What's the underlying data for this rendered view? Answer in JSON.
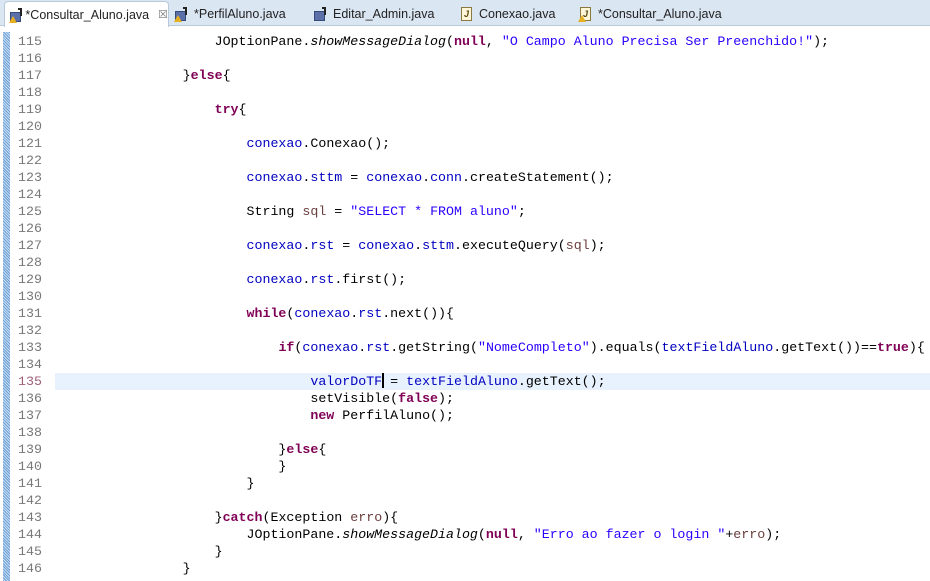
{
  "tabs": [
    {
      "label": "*Consultar_Aluno.java",
      "icon": "form-warning-icon",
      "active": true,
      "closable": true
    },
    {
      "label": "*PerfilAluno.java",
      "icon": "form-warning-icon",
      "active": false
    },
    {
      "label": "Editar_Admin.java",
      "icon": "form-icon",
      "active": false
    },
    {
      "label": "Conexao.java",
      "icon": "java-file-icon",
      "active": false
    },
    {
      "label": "*Consultar_Aluno.java",
      "icon": "java-file-warning-icon",
      "active": false
    }
  ],
  "close_glyph": "☒",
  "current_line": 135,
  "caret_after": "valorDoTF",
  "lines": [
    {
      "n": "115",
      "t": [
        [
          "p",
          "                    JOptionPane."
        ],
        [
          "it",
          "showMessageDialog"
        ],
        [
          "p",
          "("
        ],
        [
          "kw",
          "null"
        ],
        [
          "p",
          ", "
        ],
        [
          "str",
          "\"O Campo Aluno Precisa Ser Preenchido!\""
        ],
        [
          "p",
          ");"
        ]
      ]
    },
    {
      "n": "116",
      "t": []
    },
    {
      "n": "117",
      "t": [
        [
          "p",
          "                }"
        ],
        [
          "kw",
          "else"
        ],
        [
          "p",
          "{"
        ]
      ]
    },
    {
      "n": "118",
      "t": []
    },
    {
      "n": "119",
      "t": [
        [
          "p",
          "                    "
        ],
        [
          "kw",
          "try"
        ],
        [
          "p",
          "{"
        ]
      ]
    },
    {
      "n": "120",
      "t": []
    },
    {
      "n": "121",
      "t": [
        [
          "p",
          "                        "
        ],
        [
          "field",
          "conexao"
        ],
        [
          "p",
          ".Conexao();"
        ]
      ]
    },
    {
      "n": "122",
      "t": []
    },
    {
      "n": "123",
      "t": [
        [
          "p",
          "                        "
        ],
        [
          "field",
          "conexao"
        ],
        [
          "p",
          "."
        ],
        [
          "field",
          "sttm"
        ],
        [
          "p",
          " = "
        ],
        [
          "field",
          "conexao"
        ],
        [
          "p",
          "."
        ],
        [
          "field",
          "conn"
        ],
        [
          "p",
          ".createStatement();"
        ]
      ]
    },
    {
      "n": "124",
      "t": []
    },
    {
      "n": "125",
      "t": [
        [
          "p",
          "                        String "
        ],
        [
          "local",
          "sql"
        ],
        [
          "p",
          " = "
        ],
        [
          "str",
          "\"SELECT * FROM aluno\""
        ],
        [
          "p",
          ";"
        ]
      ]
    },
    {
      "n": "126",
      "t": []
    },
    {
      "n": "127",
      "t": [
        [
          "p",
          "                        "
        ],
        [
          "field",
          "conexao"
        ],
        [
          "p",
          "."
        ],
        [
          "field",
          "rst"
        ],
        [
          "p",
          " = "
        ],
        [
          "field",
          "conexao"
        ],
        [
          "p",
          "."
        ],
        [
          "field",
          "sttm"
        ],
        [
          "p",
          ".executeQuery("
        ],
        [
          "local",
          "sql"
        ],
        [
          "p",
          ");"
        ]
      ]
    },
    {
      "n": "128",
      "t": []
    },
    {
      "n": "129",
      "t": [
        [
          "p",
          "                        "
        ],
        [
          "field",
          "conexao"
        ],
        [
          "p",
          "."
        ],
        [
          "field",
          "rst"
        ],
        [
          "p",
          ".first();"
        ]
      ]
    },
    {
      "n": "130",
      "t": []
    },
    {
      "n": "131",
      "t": [
        [
          "p",
          "                        "
        ],
        [
          "kw",
          "while"
        ],
        [
          "p",
          "("
        ],
        [
          "field",
          "conexao"
        ],
        [
          "p",
          "."
        ],
        [
          "field",
          "rst"
        ],
        [
          "p",
          ".next()){"
        ]
      ]
    },
    {
      "n": "132",
      "t": []
    },
    {
      "n": "133",
      "t": [
        [
          "p",
          "                            "
        ],
        [
          "kw",
          "if"
        ],
        [
          "p",
          "("
        ],
        [
          "field",
          "conexao"
        ],
        [
          "p",
          "."
        ],
        [
          "field",
          "rst"
        ],
        [
          "p",
          ".getString("
        ],
        [
          "str",
          "\"NomeCompleto\""
        ],
        [
          "p",
          ").equals("
        ],
        [
          "field",
          "textFieldAluno"
        ],
        [
          "p",
          ".getText())=="
        ],
        [
          "kw",
          "true"
        ],
        [
          "p",
          "){"
        ]
      ]
    },
    {
      "n": "134",
      "t": []
    },
    {
      "n": "135",
      "t": [
        [
          "p",
          "                                "
        ],
        [
          "field",
          "valorDoTF"
        ],
        [
          "caret",
          ""
        ],
        [
          "p",
          " = "
        ],
        [
          "field",
          "textFieldAluno"
        ],
        [
          "p",
          ".getText();"
        ]
      ]
    },
    {
      "n": "136",
      "t": [
        [
          "p",
          "                                setVisible("
        ],
        [
          "kw",
          "false"
        ],
        [
          "p",
          ");"
        ]
      ]
    },
    {
      "n": "137",
      "t": [
        [
          "p",
          "                                "
        ],
        [
          "kw",
          "new"
        ],
        [
          "p",
          " PerfilAluno();"
        ]
      ]
    },
    {
      "n": "138",
      "t": []
    },
    {
      "n": "139",
      "t": [
        [
          "p",
          "                            }"
        ],
        [
          "kw",
          "else"
        ],
        [
          "p",
          "{"
        ]
      ]
    },
    {
      "n": "140",
      "t": [
        [
          "p",
          "                            }"
        ]
      ]
    },
    {
      "n": "141",
      "t": [
        [
          "p",
          "                        }"
        ]
      ]
    },
    {
      "n": "142",
      "t": []
    },
    {
      "n": "143",
      "t": [
        [
          "p",
          "                    }"
        ],
        [
          "kw",
          "catch"
        ],
        [
          "p",
          "(Exception "
        ],
        [
          "local",
          "erro"
        ],
        [
          "p",
          "){"
        ]
      ]
    },
    {
      "n": "144",
      "t": [
        [
          "p",
          "                        JOptionPane."
        ],
        [
          "it",
          "showMessageDialog"
        ],
        [
          "p",
          "("
        ],
        [
          "kw",
          "null"
        ],
        [
          "p",
          ", "
        ],
        [
          "str",
          "\"Erro ao fazer o login \""
        ],
        [
          "p",
          "+"
        ],
        [
          "local",
          "erro"
        ],
        [
          "p",
          ");"
        ]
      ]
    },
    {
      "n": "145",
      "t": [
        [
          "p",
          "                    }"
        ]
      ]
    },
    {
      "n": "146",
      "t": [
        [
          "p",
          "                }"
        ]
      ]
    }
  ]
}
